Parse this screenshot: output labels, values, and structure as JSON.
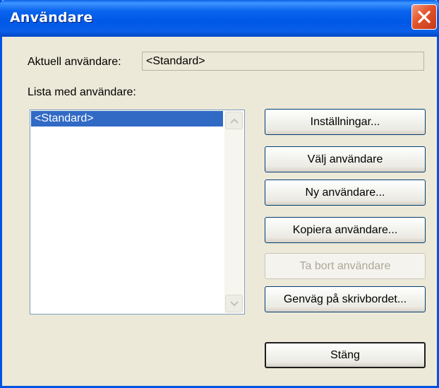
{
  "window": {
    "title": "Användare"
  },
  "current_user": {
    "label": "Aktuell användare:",
    "value": "<Standard>"
  },
  "user_list": {
    "label": "Lista med användare:",
    "items": [
      "<Standard>"
    ],
    "selected_index": 0
  },
  "buttons": {
    "settings": "Inställningar...",
    "select_user": "Välj användare",
    "new_user": "Ny användare...",
    "copy_user": "Kopiera användare...",
    "delete_user": "Ta bort användare",
    "desktop_shortcut": "Genväg på skrivbordet...",
    "close": "Stäng"
  },
  "colors": {
    "titlebar": "#0058E6",
    "selection": "#316AC5",
    "dialog_bg": "#ECE9D8",
    "close_button": "#E2542B"
  },
  "icons": {
    "close": "close-x-icon",
    "scroll_up": "scroll-up-arrow-icon",
    "scroll_down": "scroll-down-arrow-icon"
  }
}
